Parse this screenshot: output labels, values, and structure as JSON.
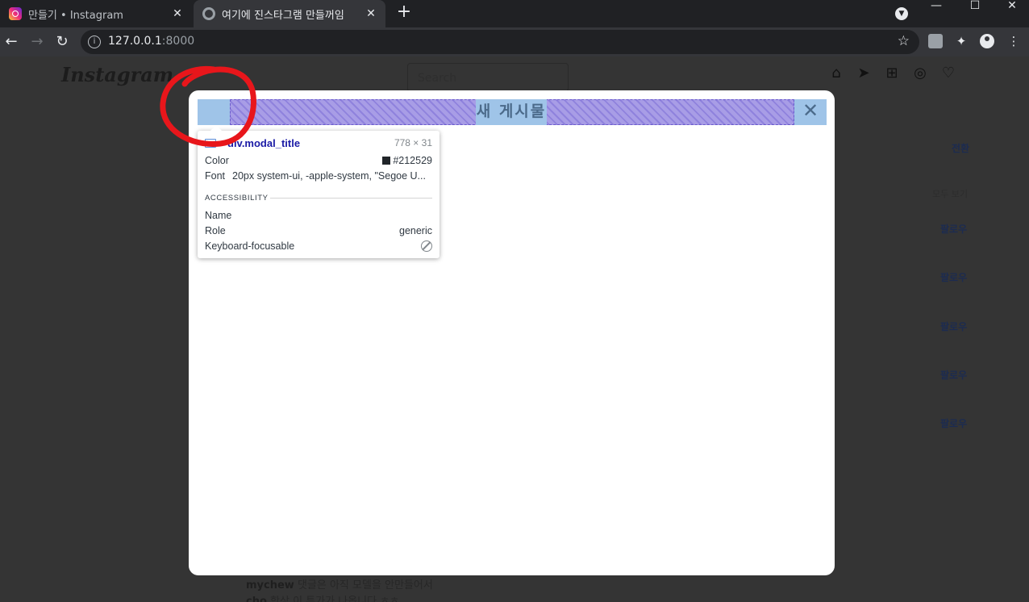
{
  "browser": {
    "tabs": [
      {
        "title": "만들기 • Instagram",
        "active": false,
        "favicon": "instagram-icon"
      },
      {
        "title": "여기에 진스타그램 만들꺼임",
        "active": true,
        "favicon": "globe-icon"
      }
    ],
    "address": {
      "host": "127.0.0.1",
      "port": ":8000"
    }
  },
  "page": {
    "logo": "Instagram",
    "search_placeholder": "Search",
    "sidebar": {
      "switch_link": "전환",
      "see_all": "모두 보기",
      "follow_labels": [
        "팔로우",
        "팔로우",
        "팔로우",
        "팔로우",
        "팔로우"
      ]
    },
    "comments": [
      {
        "user": "mychew",
        "text": "댓글은 아직 모델을 안만들어서"
      },
      {
        "user": "cho",
        "text": "항상 이 투가가 나옵니다 ㅎㅎ"
      }
    ]
  },
  "modal": {
    "title": "새 게시물",
    "close_glyph": "✕"
  },
  "devtools_tooltip": {
    "selector": "div.modal_title",
    "size": "778 × 31",
    "color_label": "Color",
    "color_value": "#212529",
    "font_label": "Font",
    "font_value": "20px system-ui, -apple-system, \"Segoe U...",
    "accessibility_header": "ACCESSIBILITY",
    "name_label": "Name",
    "role_label": "Role",
    "role_value": "generic",
    "focusable_label": "Keyboard-focusable"
  },
  "colors": {
    "annotation": "#e8161b",
    "highlight_content": "#9fc4e8",
    "highlight_padding": "#a89de6",
    "tooltip_tag": "#1a1aa6"
  }
}
